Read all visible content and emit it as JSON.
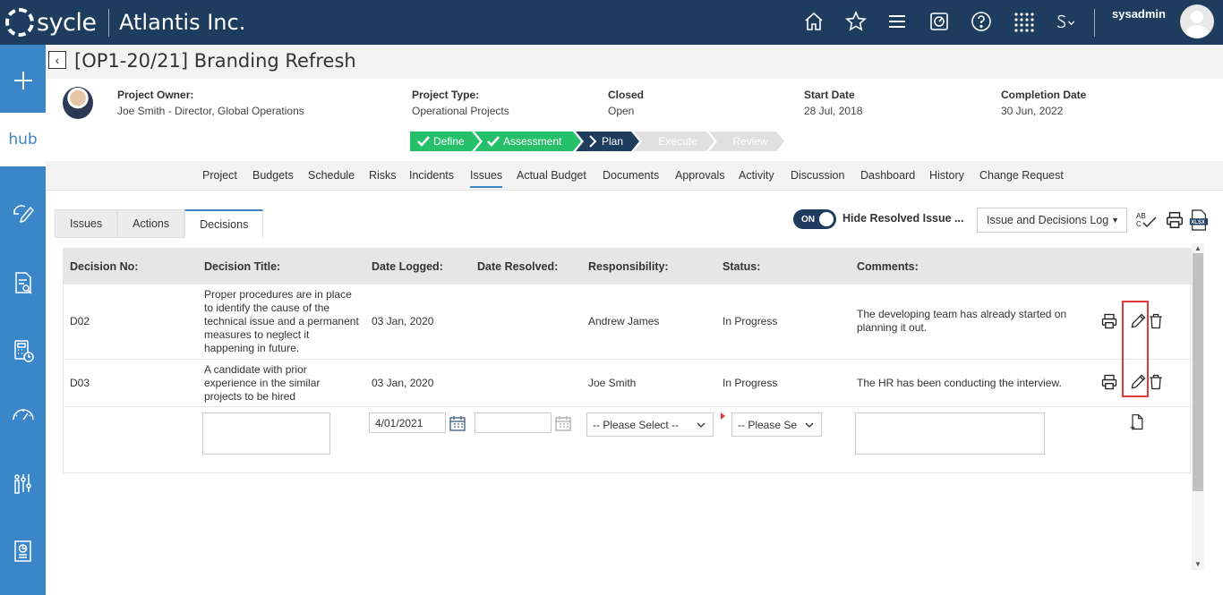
{
  "app": {
    "logo_text": "sycle",
    "company": "Atlantis Inc.",
    "user": "sysadmin"
  },
  "sidebar": {
    "hub_label": "hub"
  },
  "project": {
    "title": "[OP1-20/21] Branding Refresh",
    "owner_label": "Project Owner:",
    "owner_value": "Joe Smith - Director, Global Operations",
    "type_label": "Project Type:",
    "type_value": "Operational Projects",
    "closed_label": "Closed",
    "closed_value": "Open",
    "start_label": "Start Date",
    "start_value": "28 Jul, 2018",
    "completion_label": "Completion Date",
    "completion_value": "30 Jun, 2022"
  },
  "stages": [
    {
      "label": "Define",
      "state": "done"
    },
    {
      "label": "Assessment",
      "state": "done"
    },
    {
      "label": "Plan",
      "state": "current"
    },
    {
      "label": "Execute",
      "state": "future"
    },
    {
      "label": "Review",
      "state": "future"
    }
  ],
  "nav_tabs": [
    "Project",
    "Budgets",
    "Schedule",
    "Risks",
    "Incidents",
    "Issues",
    "Actual Budget",
    "Documents",
    "Approvals",
    "Activity",
    "Discussion",
    "Dashboard",
    "History",
    "Change Request"
  ],
  "nav_active": "Issues",
  "sub_tabs": [
    "Issues",
    "Actions",
    "Decisions"
  ],
  "sub_active": "Decisions",
  "toolbar": {
    "toggle_label": "ON",
    "hide_resolved": "Hide Resolved Issue ...",
    "log_select": "Issue and Decisions Log"
  },
  "table": {
    "headers": [
      "Decision No:",
      "Decision Title:",
      "Date Logged:",
      "Date Resolved:",
      "Responsibility:",
      "Status:",
      "Comments:"
    ],
    "rows": [
      {
        "no": "D02",
        "title": "Proper procedures are in place to identify the cause of the technical issue and a permanent measures to neglect it happening in future.",
        "logged": "03 Jan, 2020",
        "resolved": "",
        "responsibility": "Andrew James",
        "status": "In Progress",
        "comments": "The developing team has already started on planning it out."
      },
      {
        "no": "D03",
        "title": "A candidate with prior experience in the similar projects to be hired",
        "logged": "03 Jan, 2020",
        "resolved": "",
        "responsibility": "Joe Smith",
        "status": "In Progress",
        "comments": "The HR has been conducting the interview."
      }
    ],
    "new_row": {
      "date_logged": "4/01/2021",
      "responsibility_placeholder": "-- Please Select --",
      "status_placeholder": "-- Please Se"
    }
  },
  "colors": {
    "topbar": "#1d3c5e",
    "sidebar": "#3a86c8",
    "stage_done": "#27c06a",
    "stage_current": "#1d3c5e",
    "highlight": "#e23a3a"
  }
}
